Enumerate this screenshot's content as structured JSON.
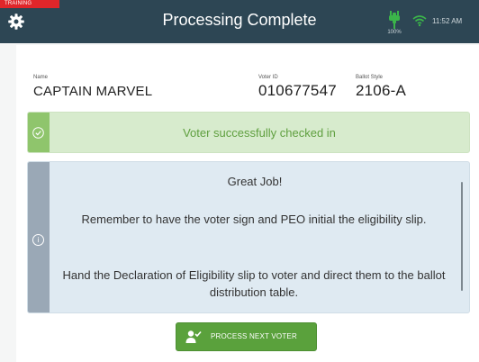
{
  "header": {
    "training_badge": "TRAINING",
    "title": "Processing Complete",
    "battery_level": "100%",
    "time": "11:52 AM"
  },
  "voter": {
    "name_label": "Name",
    "name_value": "CAPTAIN MARVEL",
    "voter_id_label": "Voter ID",
    "voter_id_value": "010677547",
    "ballot_style_label": "Ballot Style",
    "ballot_style_value": "2106-A"
  },
  "success": {
    "message": "Voter successfully checked in"
  },
  "info": {
    "heading": "Great Job!",
    "paragraph_1": "Remember to have the voter sign and PEO initial the eligibility slip.",
    "paragraph_2": "Hand the Declaration of Eligibility slip to voter and direct them to the ballot distribution table."
  },
  "actions": {
    "process_next_label": "PROCESS NEXT VOTER"
  },
  "colors": {
    "header_bg": "#2d4654",
    "training_red": "#e0262a",
    "success_green": "#8fc56c",
    "success_text": "#5f9f3f",
    "button_green": "#5aa13c",
    "info_bg": "#dfeaf2",
    "info_strip": "#9aa8b6",
    "status_icon_green": "#3bb54a"
  },
  "icons": {
    "settings": "gear-icon",
    "battery": "battery-charging-icon",
    "wifi": "wifi-icon",
    "success": "check-circle-icon",
    "info": "info-circle-icon",
    "process": "user-check-icon"
  }
}
